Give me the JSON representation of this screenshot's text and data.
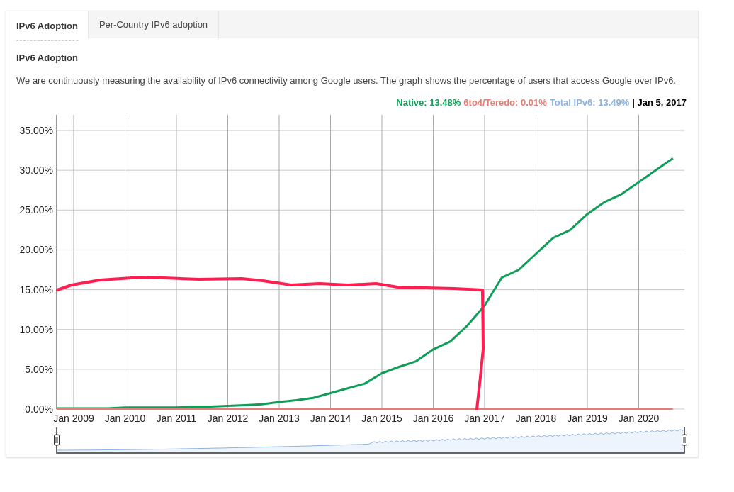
{
  "tabs": [
    {
      "label": "IPv6 Adoption",
      "selected": true
    },
    {
      "label": "Per-Country IPv6 adoption",
      "selected": false
    }
  ],
  "heading": "IPv6 Adoption",
  "description": "We are continuously measuring the availability of IPv6 connectivity among Google users. The graph shows the percentage of users that access Google over IPv6.",
  "legend": [
    {
      "kind": "series",
      "value": ": 13.48%"
    },
    {
      "kind": "series",
      "value": ": 0.01%"
    },
    {
      "kind": "text",
      "value": "Total IPv6: 13.49%",
      "color": "#8db3e2"
    },
    {
      "kind": "text",
      "value": "| Jan 5, 2017",
      "color": "#000000"
    }
  ],
  "chart_data": {
    "type": "line",
    "categories": [
      null,
      "Jan 2009",
      null,
      null,
      "Jan 2010",
      null,
      null,
      "Jan 2011",
      null,
      null,
      "Jan 2012",
      null,
      null,
      "Jan 2013",
      null,
      null,
      "Jan 2014",
      null,
      null,
      "Jan 2015",
      null,
      null,
      "Jan 2016",
      null,
      null,
      "Jan 2017",
      null,
      null,
      "Jan 2018",
      null,
      null,
      "Jan 2019",
      null,
      null,
      "Jan 2020",
      null,
      null
    ],
    "series": [
      {
        "name": "Native",
        "color": "#0f9d58",
        "values": [
          0.1,
          0.1,
          0.1,
          0.1,
          0.2,
          0.2,
          0.2,
          0.2,
          0.3,
          0.3,
          0.4,
          0.5,
          0.6,
          0.9,
          1.1,
          1.4,
          2.0,
          2.6,
          3.2,
          4.5,
          5.3,
          6.0,
          7.5,
          8.5,
          10.5,
          13,
          16.5,
          17.5,
          19.5,
          21.5,
          22.5,
          24.5,
          26,
          27,
          28.5,
          30,
          31.5
        ]
      },
      {
        "name": "6to4/Teredo",
        "color": "#e67c73",
        "values": [
          0,
          0,
          0,
          0,
          0,
          0,
          0,
          0,
          0,
          0,
          0,
          0,
          0,
          0,
          0,
          0,
          0,
          0,
          0,
          0,
          0,
          0,
          0,
          0,
          0,
          0,
          0,
          0,
          0,
          0,
          0,
          0,
          0,
          0,
          0,
          0,
          0
        ]
      }
    ],
    "ylim": [
      0,
      35
    ],
    "grid": true,
    "yticks": [
      {
        "value": 0,
        "label": "0.00%"
      },
      {
        "value": 5,
        "label": "5.00%"
      },
      {
        "value": 10,
        "label": "10.00%"
      },
      {
        "value": 15,
        "label": "15.00%"
      },
      {
        "value": 20,
        "label": "20.00%"
      },
      {
        "value": 25,
        "label": "25.00%"
      },
      {
        "value": 30,
        "label": "30.00%"
      },
      {
        "value": 35,
        "label": "35.00%"
      }
    ]
  }
}
